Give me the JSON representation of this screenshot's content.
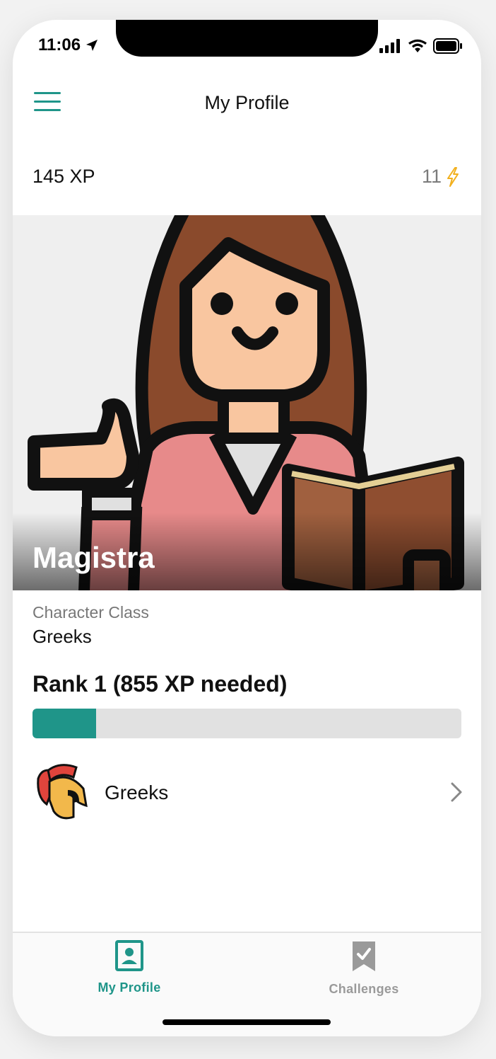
{
  "status_bar": {
    "time": "11:06"
  },
  "header": {
    "title": "My Profile"
  },
  "stats": {
    "xp": "145 XP",
    "energy": "11"
  },
  "character": {
    "name": "Magistra",
    "class_label": "Character Class",
    "class_value": "Greeks"
  },
  "rank": {
    "text": "Rank 1 (855 XP needed)",
    "progress_fraction": 0.148
  },
  "group": {
    "label": "Greeks"
  },
  "tabs": [
    {
      "label": "My Profile",
      "active": true
    },
    {
      "label": "Challenges",
      "active": false
    }
  ],
  "colors": {
    "accent": "#1f9589",
    "energy_bolt": "#f2b01e",
    "inactive_tab": "#9a9a9a"
  },
  "icons": {
    "menu": "hamburger-icon",
    "energy": "lightning-icon",
    "group": "spartan-helmet-icon",
    "chevron": "chevron-right-icon",
    "profile_tab": "profile-icon",
    "challenges_tab": "bookmark-check-icon"
  }
}
